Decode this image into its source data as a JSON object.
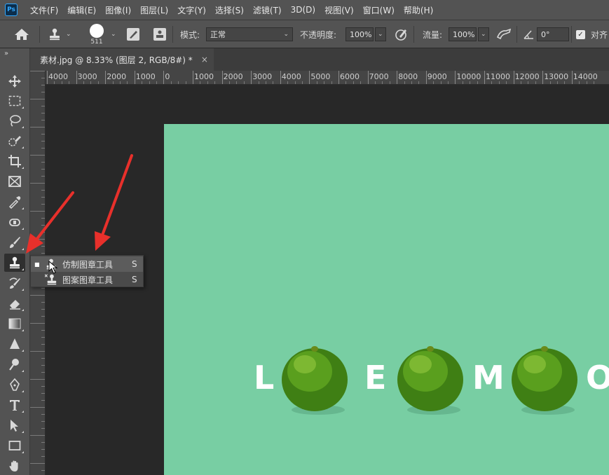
{
  "app": {
    "logo": "Ps"
  },
  "menu": [
    "文件(F)",
    "编辑(E)",
    "图像(I)",
    "图层(L)",
    "文字(Y)",
    "选择(S)",
    "滤镜(T)",
    "3D(D)",
    "视图(V)",
    "窗口(W)",
    "帮助(H)"
  ],
  "options": {
    "brush_size": "511",
    "mode_label": "模式:",
    "mode_value": "正常",
    "opacity_label": "不透明度:",
    "opacity_value": "100%",
    "flow_label": "流量:",
    "flow_value": "100%",
    "angle_value": "0°",
    "align_label": "对齐"
  },
  "document_tab": {
    "title": "素材.jpg @ 8.33% (图层 2, RGB/8#) *",
    "close": "×"
  },
  "ruler": {
    "h_labels": [
      "4000",
      "3000",
      "2000",
      "1000",
      "0",
      "1000",
      "2000",
      "3000",
      "4000",
      "5000",
      "6000",
      "7000",
      "8000",
      "9000",
      "10000",
      "11000",
      "12000",
      "13000",
      "14000"
    ]
  },
  "flyout": {
    "items": [
      {
        "label": "仿制图章工具",
        "shortcut": "S",
        "selected": true
      },
      {
        "label": "图案图章工具",
        "shortcut": "S",
        "selected": false
      }
    ]
  },
  "canvas_text": {
    "l1": "L",
    "l2": "E",
    "l3": "M",
    "l4": "O"
  },
  "colors": {
    "image_bg": "#78cea3",
    "annotation_arrow": "#e8302b",
    "ui_panel": "#535353",
    "workspace": "#282828"
  }
}
